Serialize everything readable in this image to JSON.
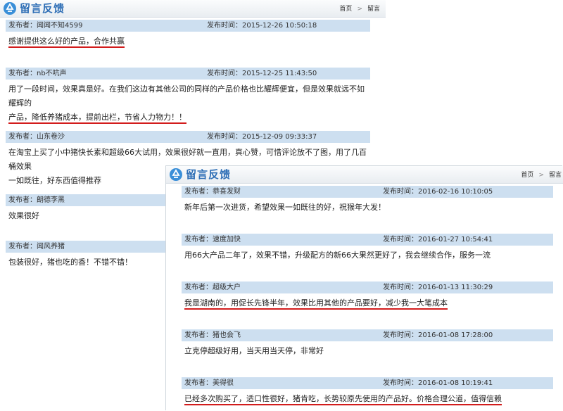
{
  "panel1": {
    "title": "留言反馈",
    "breadcrumb": {
      "home": "首页",
      "sep": ">",
      "current": "留言"
    },
    "entries": [
      {
        "author": "发布者：闻闻不知4599",
        "time": "发布时间：2015-12-26 10:50:18",
        "lines": [
          "感谢提供这么好的产品，合作共赢"
        ]
      },
      {
        "author": "发布者：nb不吭声",
        "time": "发布时间：2015-12-25 11:43:50",
        "lines": [
          "用了一段时间，效果真是好。在我们这边有其他公司的同样的产品价格也比耀辉便宜，但是效果就远不如耀辉的",
          "产品，降低养猪成本，提前出栏，节省人力物力！！"
        ]
      },
      {
        "author": "发布者：山东卷沙",
        "time": "发布时间：2015-12-09 09:33:37",
        "lines": [
          "在淘宝上买了小中猪快长素和超级66大试用，效果很好就一直用，真心赞，可惜评论放不了图，用了几百桶效果",
          "一如既往，好东西值得推荐"
        ]
      },
      {
        "author": "发布者：朗德李黑",
        "time": "",
        "lines": [
          "效果很好"
        ]
      },
      {
        "author": "发布者：闻风养猪",
        "time": "",
        "lines": [
          "包装很好，猪也吃的香！不错不错！"
        ]
      }
    ]
  },
  "panel2": {
    "title": "留言反馈",
    "breadcrumb": {
      "home": "首页",
      "sep": ">",
      "current": "留言"
    },
    "entries": [
      {
        "author": "发布者：恭喜发财",
        "time": "发布时间：2016-02-16 10:10:05",
        "lines": [
          "新年后第一次进货，希望效果一如既往的好，祝猴年大发！"
        ]
      },
      {
        "author": "发布者：速度加快",
        "time": "发布时间：2016-01-27 10:54:41",
        "lines": [
          "用66大产品二年了，效果不错，升级配方的新66大果然更好了，我会继续合作，服务一流"
        ]
      },
      {
        "author": "发布者：超级大户",
        "time": "发布时间：2016-01-13 11:30:29",
        "lines": [
          "我是湖南的，用促长先锋半年，效果比用其他的产品要好，减少我一大笔成本"
        ]
      },
      {
        "author": "发布者：猪也会飞",
        "time": "发布时间：2016-01-08 17:28:00",
        "lines": [
          "立克停超级好用，当天用当天停，非常好"
        ]
      },
      {
        "author": "发布者：美得很",
        "time": "发布时间：2016-01-08 10:19:41",
        "lines": [
          "已经多次购买了，适口性很好，猪肯吃，长势较原先使用的产品好。价格合理公道，值得信赖"
        ]
      }
    ]
  },
  "colors": {
    "header_bar": "#cddff0",
    "title": "#2f6fb6",
    "underline": "#d21c1c"
  }
}
